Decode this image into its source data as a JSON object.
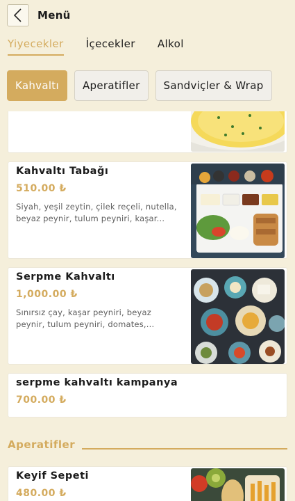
{
  "header": {
    "back_icon": "chevron-left-icon",
    "title": "Menü"
  },
  "tabs": [
    {
      "label": "Yiyecekler",
      "active": true
    },
    {
      "label": "İçecekler",
      "active": false
    },
    {
      "label": "Alkol",
      "active": false
    }
  ],
  "chips": [
    {
      "label": "Kahvaltı",
      "active": true
    },
    {
      "label": "Aperatifler",
      "active": false
    },
    {
      "label": "Sandviçler & Wrap",
      "active": false
    }
  ],
  "items": [
    {
      "name": "",
      "price": "",
      "desc": "",
      "image": "omelette"
    },
    {
      "name": "Kahvaltı Tabağı",
      "price": "510.00 ₺",
      "desc": "Siyah, yeşil zeytin, çilek reçeli, nutella, beyaz peynir, tulum peyniri, kaşar...",
      "image": "breakfast-plate"
    },
    {
      "name": "Serpme Kahvaltı",
      "price": "1,000.00 ₺",
      "desc": "Sınırsız çay, kaşar peyniri, beyaz peynir, tulum peyniri, domates,...",
      "image": "spread-breakfast"
    },
    {
      "name": "serpme kahvaltı kampanya",
      "price": "700.00 ₺",
      "desc": ""
    }
  ],
  "section": {
    "title": "Aperatifler"
  },
  "next_item": {
    "name": "Keyif Sepeti",
    "price": "480.00 ₺",
    "image": "snack-basket"
  },
  "colors": {
    "accent": "#d4ab5e",
    "background": "#f5efdb"
  }
}
